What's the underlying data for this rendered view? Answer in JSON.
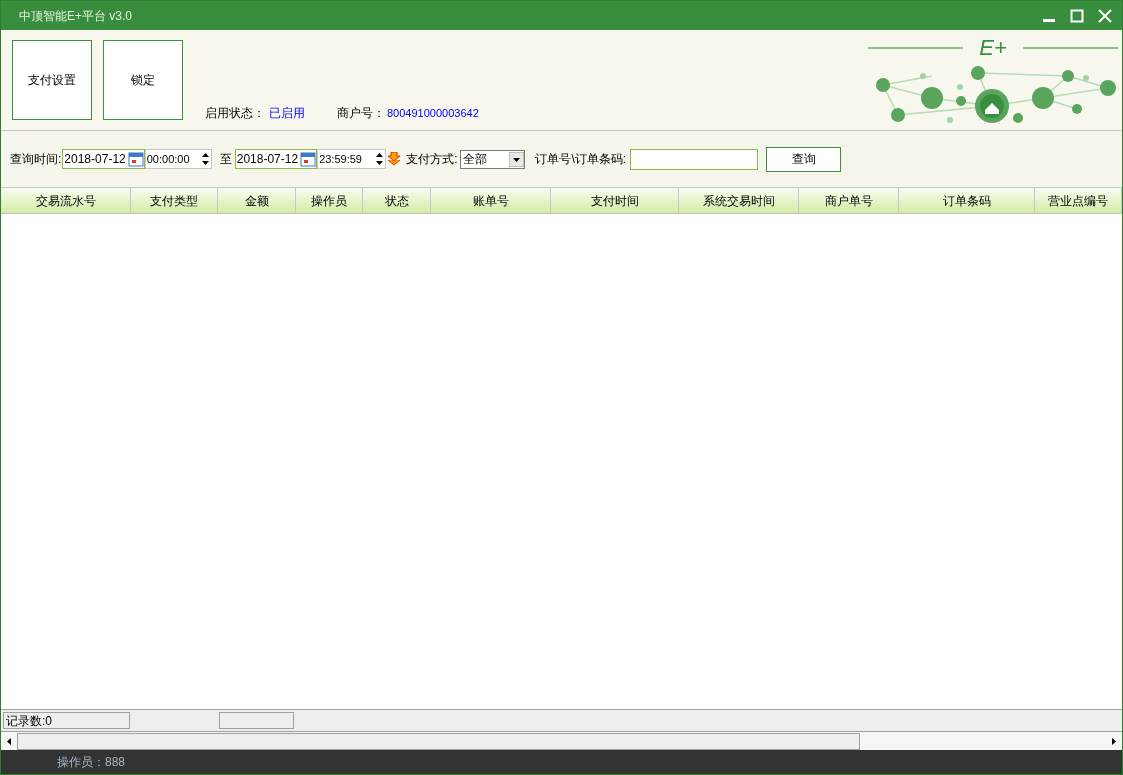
{
  "window": {
    "title": "中顶智能E+平台 v3.0"
  },
  "toolbar": {
    "buttons": [
      "支付设置",
      "锁定"
    ],
    "status_label": "启用状态：",
    "status_value": "已启用",
    "merchant_label": "商户号：",
    "merchant_value": "800491000003642"
  },
  "logo": {
    "text": "E+"
  },
  "filter": {
    "time_label": "查询时间:",
    "start_date": "2018-07-12",
    "start_time": "00:00:00",
    "to_label": "至",
    "end_date": "2018-07-12",
    "end_time": "23:59:59",
    "pay_label": "支付方式:",
    "pay_value": "全部",
    "order_label": "订单号\\订单条码:",
    "query_button": "查询"
  },
  "table": {
    "columns": [
      "交易流水号",
      "支付类型",
      "金额",
      "操作员",
      "状态",
      "账单号",
      "支付时间",
      "系统交易时间",
      "商户单号",
      "订单条码",
      "营业点编号"
    ]
  },
  "status_bar": {
    "record_count": "记录数:0"
  },
  "footer": {
    "operator": "操作员：888"
  }
}
